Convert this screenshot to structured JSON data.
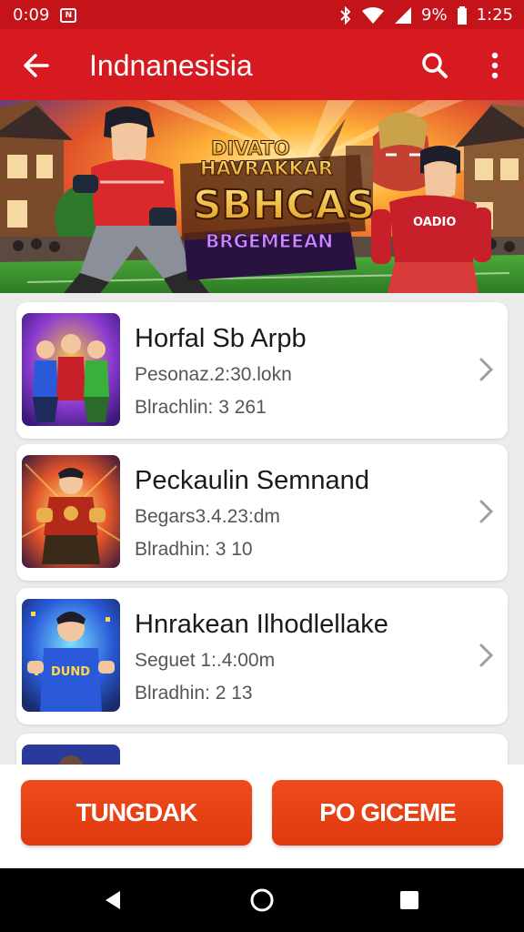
{
  "status_bar": {
    "time_left": "0:09",
    "notif_glyph": "N",
    "battery_text": "9%",
    "time_right": "1:25",
    "icons": [
      "notification-icon",
      "bluetooth-icon",
      "wifi-icon",
      "signal-icon",
      "battery-icon"
    ]
  },
  "app_bar": {
    "title": "Indnanesisia",
    "icons": [
      "back-arrow-icon",
      "search-icon",
      "more-vert-icon"
    ]
  },
  "banner": {
    "line1": "DIVATO",
    "line2": "HAVRAKKAR",
    "line3": "SBHCAS",
    "line4": "BRGEMEEAN",
    "jersey_text": "OADIO"
  },
  "games": [
    {
      "title": "Horfal Sb Arpb",
      "subtitle": "Pesonaz.2:30.lokn",
      "meta": "Blrachlin: 3 261"
    },
    {
      "title": "Peckaulin Semnand",
      "subtitle": "Begars3.4.23:dm",
      "meta": "Blradhin: 3 10"
    },
    {
      "title": "Hnrakean Ilhodlellake",
      "subtitle": "Seguet 1:.4:00m",
      "meta": "Blradhin: 2 13",
      "jersey_text": "DUND"
    },
    {
      "title": "",
      "subtitle": "",
      "meta": ""
    }
  ],
  "buttons": {
    "left": "TUNGDAK",
    "right": "PO GICEME"
  },
  "colors": {
    "primary": "#d71920",
    "status": "#c4141a",
    "button": "#e8401a",
    "chevron": "#9e9e9e"
  }
}
